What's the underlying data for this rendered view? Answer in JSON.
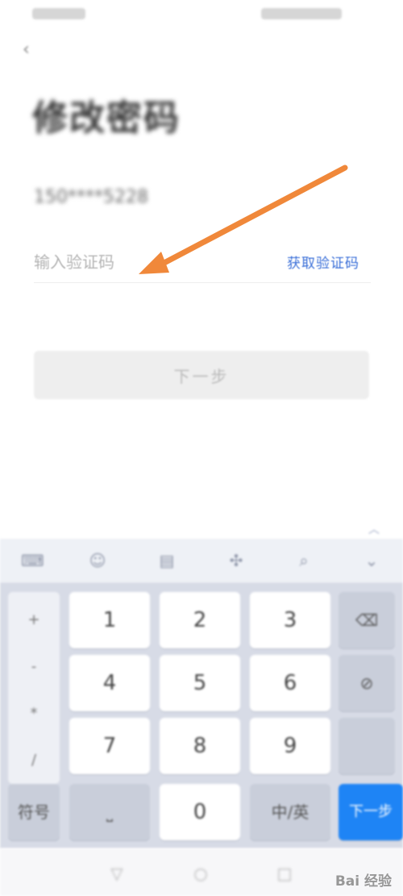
{
  "header": {
    "title": "修改密码",
    "phone_masked": "150****5228"
  },
  "verify": {
    "placeholder": "输入验证码",
    "get_code_label": "获取验证码"
  },
  "actions": {
    "next_label": "下一步"
  },
  "keyboard": {
    "toolbar_icons": [
      "keyboard-switch-icon",
      "emoji-icon",
      "clipboard-icon",
      "cursor-icon",
      "search-icon",
      "collapse-icon"
    ],
    "side_symbols": [
      "+",
      "-",
      "*",
      "/"
    ],
    "digits": [
      "1",
      "2",
      "3",
      "4",
      "5",
      "6",
      "7",
      "8",
      "9"
    ],
    "symbols_key": "符号",
    "space_key": "",
    "zero_key": "0",
    "abc_key": "中/英",
    "backspace_icon": "backspace-icon",
    "enter_key": "下一步"
  },
  "watermark": {
    "text": "Bai 经验"
  },
  "colors": {
    "accent": "#3a6fd8",
    "arrow": "#f0883a",
    "enter": "#1e84f5"
  }
}
